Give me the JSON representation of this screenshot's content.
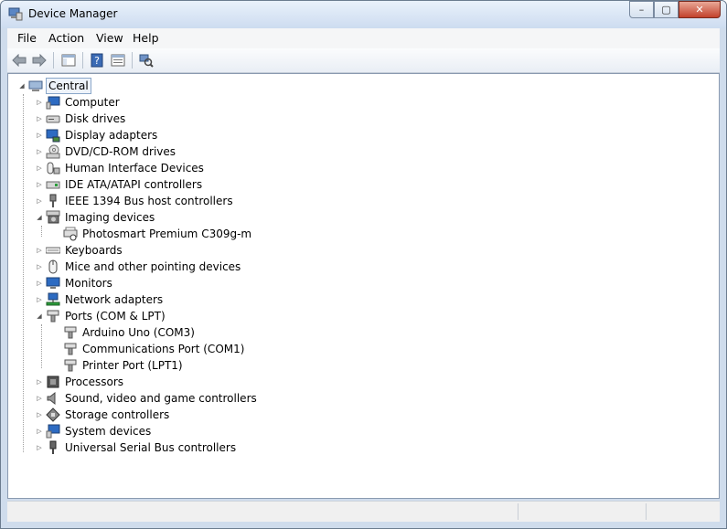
{
  "window": {
    "title": "Device Manager"
  },
  "caption": {
    "minimize": "–",
    "maximize": "▢",
    "close": "✕"
  },
  "menu": [
    {
      "label": "File"
    },
    {
      "label": "Action"
    },
    {
      "label": "View"
    },
    {
      "label": "Help"
    }
  ],
  "toolbar": {
    "back_icon": "back-arrow-icon",
    "forward_icon": "forward-arrow-icon",
    "show_hide_icon": "console-tree-icon",
    "help_icon": "help-icon",
    "properties_icon": "properties-icon",
    "scan_icon": "scan-hardware-icon"
  },
  "tree": {
    "root": "Central",
    "items": [
      {
        "label": "Computer",
        "expanded": false
      },
      {
        "label": "Disk drives",
        "expanded": false
      },
      {
        "label": "Display adapters",
        "expanded": false
      },
      {
        "label": "DVD/CD-ROM drives",
        "expanded": false
      },
      {
        "label": "Human Interface Devices",
        "expanded": false
      },
      {
        "label": "IDE ATA/ATAPI controllers",
        "expanded": false
      },
      {
        "label": "IEEE 1394 Bus host controllers",
        "expanded": false
      },
      {
        "label": "Imaging devices",
        "expanded": true,
        "children": [
          "Photosmart Premium C309g-m"
        ]
      },
      {
        "label": "Keyboards",
        "expanded": false
      },
      {
        "label": "Mice and other pointing devices",
        "expanded": false
      },
      {
        "label": "Monitors",
        "expanded": false
      },
      {
        "label": "Network adapters",
        "expanded": false
      },
      {
        "label": "Ports (COM & LPT)",
        "expanded": true,
        "children": [
          "Arduino Uno (COM3)",
          "Communications Port (COM1)",
          "Printer Port (LPT1)"
        ]
      },
      {
        "label": "Processors",
        "expanded": false
      },
      {
        "label": "Sound, video and game controllers",
        "expanded": false
      },
      {
        "label": "Storage controllers",
        "expanded": false
      },
      {
        "label": "System devices",
        "expanded": false
      },
      {
        "label": "Universal Serial Bus controllers",
        "expanded": false
      }
    ]
  },
  "colors": {
    "titlebar": "#d6e3f3",
    "close": "#c2412b",
    "selection_border": "#8aa7c9"
  }
}
